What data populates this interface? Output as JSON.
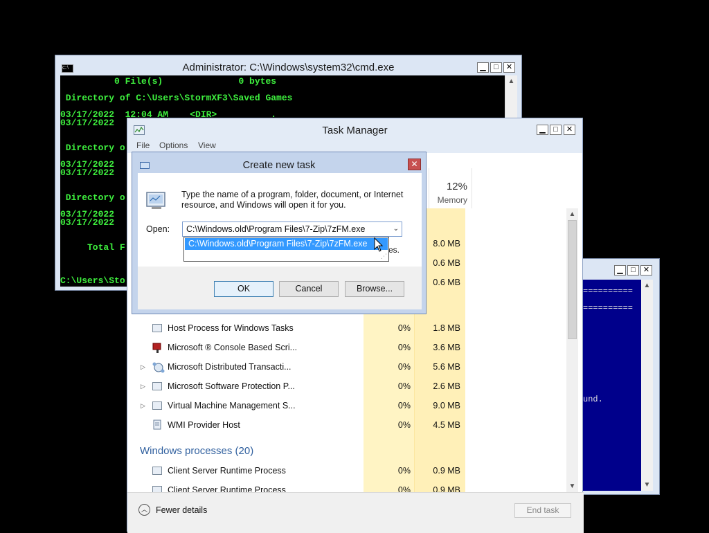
{
  "cmd_window": {
    "title": "Administrator: C:\\Windows\\system32\\cmd.exe",
    "icon": "console-icon",
    "lines": [
      "          0 File(s)              0 bytes",
      " Directory of C:\\Users\\StormXF3\\Saved Games",
      "03/17/2022  12:04 AM    <DIR>          .",
      "03/17/2022",
      " Directory o",
      "03/17/2022",
      "03/17/2022",
      " Directory o",
      "03/17/2022",
      "03/17/2022",
      "     Total F",
      "C:\\Users\\Sto"
    ]
  },
  "blue_window": {
    "lines": [
      "==========",
      "==========",
      "und."
    ]
  },
  "task_manager": {
    "title": "Task Manager",
    "icon": "task-manager-icon",
    "menu": [
      "File",
      "Options",
      "View"
    ],
    "memory_header": {
      "percent": "12%",
      "label": "Memory"
    },
    "top_rows": [
      {
        "mem": "8.0 MB"
      },
      {
        "mem": "0.6 MB"
      },
      {
        "mem": "0.6 MB"
      }
    ],
    "processes": [
      {
        "name": "Host Process for Windows Tasks",
        "cpu": "0%",
        "mem": "1.8 MB",
        "expandable": false,
        "icon": "window-app-icon"
      },
      {
        "name": "Microsoft ® Console Based Scri...",
        "cpu": "0%",
        "mem": "3.6 MB",
        "expandable": false,
        "icon": "script-icon"
      },
      {
        "name": "Microsoft Distributed Transacti...",
        "cpu": "0%",
        "mem": "5.6 MB",
        "expandable": true,
        "icon": "network-icon"
      },
      {
        "name": "Microsoft Software Protection P...",
        "cpu": "0%",
        "mem": "2.6 MB",
        "expandable": true,
        "icon": "window-app-icon"
      },
      {
        "name": "Virtual Machine Management S...",
        "cpu": "0%",
        "mem": "9.0 MB",
        "expandable": true,
        "icon": "window-app-icon"
      },
      {
        "name": "WMI Provider Host",
        "cpu": "0%",
        "mem": "4.5 MB",
        "expandable": false,
        "icon": "wmi-icon"
      }
    ],
    "group_windows": "Windows processes (20)",
    "windows_processes": [
      {
        "name": "Client Server Runtime Process",
        "cpu": "0%",
        "mem": "0.9 MB",
        "expandable": false,
        "icon": "window-app-icon"
      },
      {
        "name": "Client Server Runtime Process",
        "cpu": "0%",
        "mem": "0.9 MB",
        "expandable": false,
        "icon": "window-app-icon"
      }
    ],
    "fewer_details": "Fewer details",
    "end_task": "End task"
  },
  "dialog": {
    "title": "Create new task",
    "description": "Type the name of a program, folder, document, or Internet resource, and Windows will open it for you.",
    "open_label": "Open:",
    "open_value": "C:\\Windows.old\\Program Files\\7-Zip\\7zFM.exe",
    "dropdown_item": "C:\\Windows.old\\Program Files\\7-Zip\\7zFM.exe",
    "hidden_text_fragment": "es.",
    "ok": "OK",
    "cancel": "Cancel",
    "browse": "Browse..."
  }
}
